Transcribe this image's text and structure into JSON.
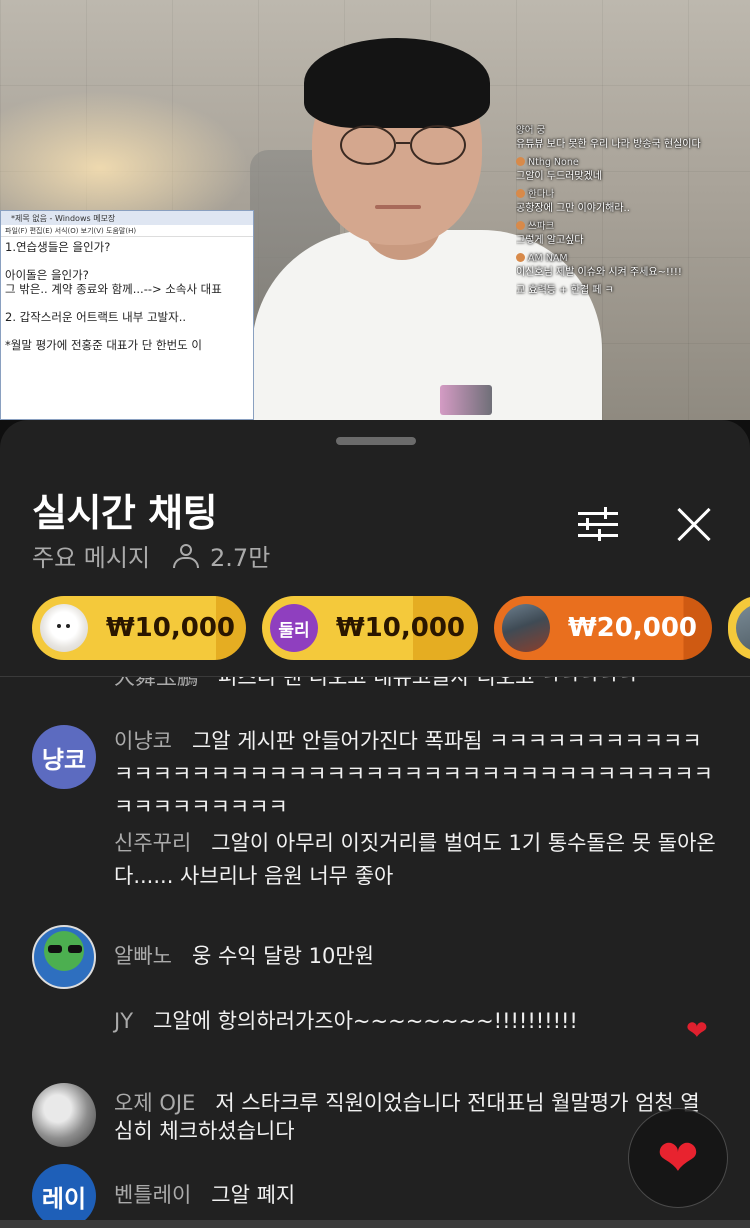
{
  "video": {
    "notepad": {
      "title": "*제목 없음 - Windows 메모장",
      "menu": "파일(F)   편집(E)   서식(O)   보기(V)   도움말(H)",
      "body": "1.연습생들은 을인가?\n\n아이돌은 을인가?\n그 밖은.. 계약 종료와 함께...--> 소속사 대표\n\n2. 갑작스러운 어트랙트 내부 고발자..\n\n*월말 평가에 전홍준 대표가 단 한번도 이"
    },
    "overlay_chat": [
      {
        "name": "양어 궁",
        "text": "유튜뷰 보다 못한 우리 나라 방송국 현실이다"
      },
      {
        "name": "Nthg None",
        "text": "그알이 두드러맞겠네"
      },
      {
        "name": "한다나",
        "text": "공항장에 그만 이야기해라.."
      },
      {
        "name": "쓰파크",
        "text": "그렇게 알고싶다"
      },
      {
        "name": "AM NAM",
        "text": "이신호님 제발 이슈와 시켜 주세요~!!!!"
      },
      {
        "name": "",
        "text": "교 효력등 + 한겹 페 ㅋ"
      }
    ]
  },
  "sheet": {
    "title": "실시간 채팅",
    "mode": "주요 메시지",
    "viewers": "2.7만",
    "tune_icon": "tune-icon",
    "close_icon": "close-icon"
  },
  "tickers": [
    {
      "avatar_text": "",
      "amount": "₩10,000",
      "color": "#f4c93b"
    },
    {
      "avatar_text": "둘리",
      "amount": "₩10,000",
      "color": "#f4c93b"
    },
    {
      "avatar_text": "",
      "amount": "₩20,000",
      "color": "#e96f1e"
    },
    {
      "avatar_text": "",
      "amount": "",
      "color": "#f4c93b"
    }
  ],
  "messages": [
    {
      "author": "大舞玉鵬",
      "text": "퍼즈디 랜 디오고 내뷰고글자 디오고 ㅋㅋㅋㅋㅋ"
    },
    {
      "avatar_text": "냥코",
      "author": "이냥코",
      "text": "그알 게시판 안들어가진다 폭파됨 ㅋㅋㅋㅋㅋㅋㅋㅋㅋㅋㅋㅋㅋㅋㅋㅋㅋㅋㅋㅋㅋㅋㅋㅋㅋㅋㅋㅋㅋㅋㅋㅋㅋㅋㅋㅋㅋㅋㅋㅋㅋㅋㅋㅋㅋㅋㅋㅋㅋㅋㅋ"
    },
    {
      "author": "신주꾸리",
      "text": "그알이 아무리 이짓거리를 벌여도 1기 통수돌은 못 돌아온다...... 사브리나 음원 너무 좋아"
    },
    {
      "author": "알빠노",
      "text": "웅 수익 달랑 10만원"
    },
    {
      "author": "JY",
      "text": "그알에 항의하러가즈아~~~~~~~~!!!!!!!!!!"
    },
    {
      "author": "오제 OJE",
      "text": "저 스타크루 직원이었습니다 전대표님 월말평가 엄청 열심히 체크하셨습니다"
    },
    {
      "avatar_text": "레이",
      "author": "벤틀레이",
      "text": "그알 폐지"
    }
  ],
  "reaction": {
    "icon": "heart-icon",
    "glyph": "❤"
  }
}
